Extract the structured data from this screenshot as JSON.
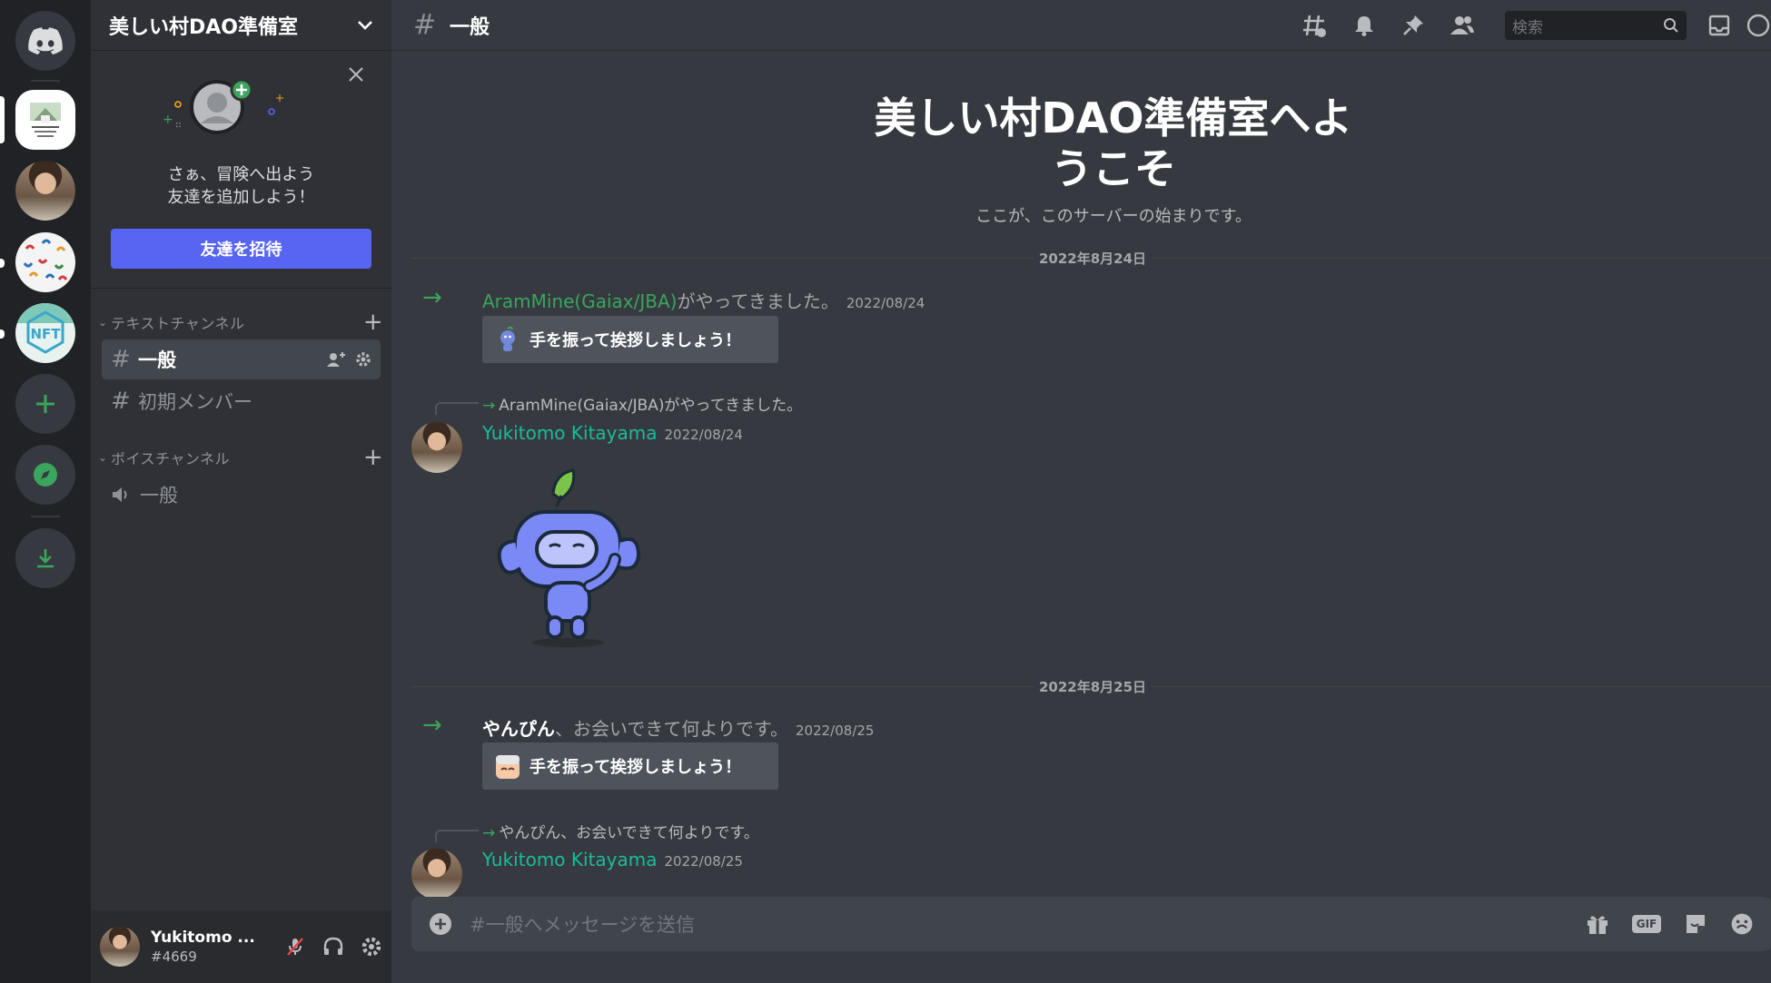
{
  "server": {
    "name": "美しい村DAO準備室",
    "invite_text_line1": "さぁ、冒険へ出よう",
    "invite_text_line2": "友達を追加しよう！",
    "invite_button": "友達を招待"
  },
  "categories": [
    {
      "label": "テキストチャンネル",
      "channels": [
        "一般",
        "初期メンバー"
      ]
    },
    {
      "label": "ボイスチャンネル",
      "channels": [
        "一般"
      ]
    }
  ],
  "user": {
    "name": "Yukitomo ...",
    "tag": "#4669"
  },
  "topbar": {
    "channel": "一般",
    "search_placeholder": "検索"
  },
  "welcome": {
    "title_line1": "美しい村DAO準備室へよ",
    "title_line2": "うこそ",
    "subtitle": "ここが、このサーバーの始まりです。"
  },
  "dividers": [
    "2022年8月24日",
    "2022年8月25日"
  ],
  "messages": [
    {
      "type": "join",
      "username": "AramMine(Gaiax/JBA)",
      "text": "がやってきました。",
      "timestamp": "2022/08/24",
      "wave_button": "手を振って挨拶しましょう！"
    },
    {
      "type": "reply",
      "reply_text": "AramMine(Gaiax/JBA)がやってきました。",
      "author": "Yukitomo Kitayama",
      "timestamp": "2022/08/24",
      "sticker": "wumpus-wave-sticker"
    },
    {
      "type": "join",
      "username": "やんぴん",
      "text": "、お会いできて何よりです。",
      "timestamp": "2022/08/25",
      "wave_button": "手を振って挨拶しましょう！"
    },
    {
      "type": "reply",
      "reply_text": "やんぴん、お会いできて何よりです。",
      "author": "Yukitomo Kitayama",
      "timestamp": "2022/08/25"
    }
  ],
  "composer": {
    "placeholder": "#一般へメッセージを送信",
    "gif_label": "GIF"
  },
  "colors": {
    "accent": "#5865f2",
    "online_green": "#3ba55d",
    "author_teal": "#1abc9c",
    "bg_main": "#36393f",
    "bg_sidebar": "#2f3136",
    "bg_rail": "#202225"
  }
}
